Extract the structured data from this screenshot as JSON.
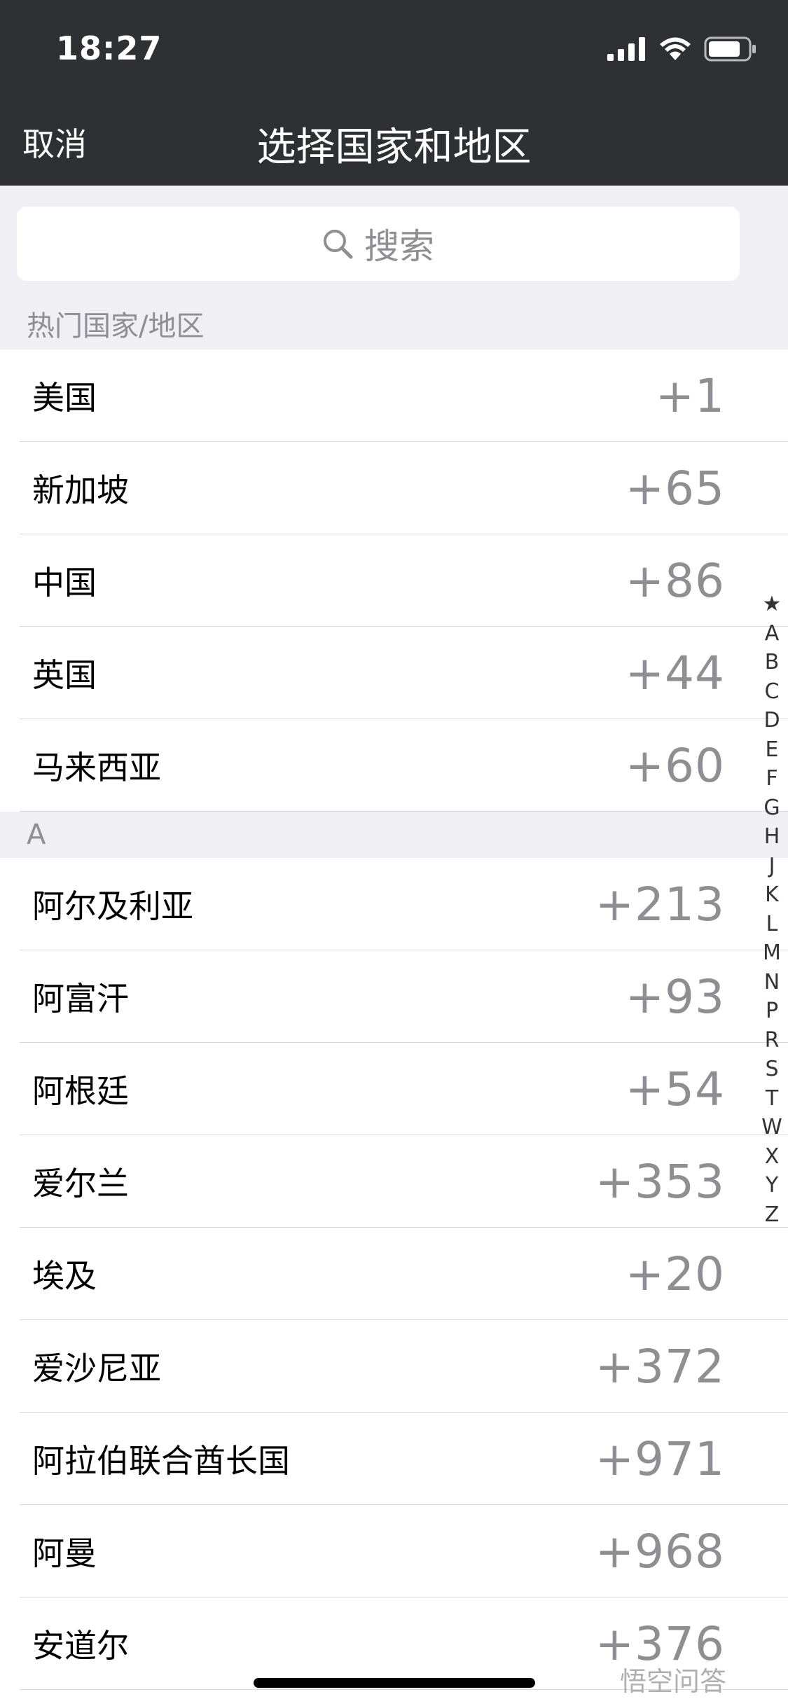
{
  "status_bar": {
    "time": "18:27"
  },
  "nav": {
    "cancel_label": "取消",
    "title": "选择国家和地区"
  },
  "search": {
    "placeholder": "搜索"
  },
  "popular": {
    "header": "热门国家/地区",
    "items": [
      {
        "name": "美国",
        "code": "+1"
      },
      {
        "name": "新加坡",
        "code": "+65"
      },
      {
        "name": "中国",
        "code": "+86"
      },
      {
        "name": "英国",
        "code": "+44"
      },
      {
        "name": "马来西亚",
        "code": "+60"
      }
    ]
  },
  "section_a": {
    "header": "A",
    "items": [
      {
        "name": "阿尔及利亚",
        "code": "+213"
      },
      {
        "name": "阿富汗",
        "code": "+93"
      },
      {
        "name": "阿根廷",
        "code": "+54"
      },
      {
        "name": "爱尔兰",
        "code": "+353"
      },
      {
        "name": "埃及",
        "code": "+20"
      },
      {
        "name": "爱沙尼亚",
        "code": "+372"
      },
      {
        "name": "阿拉伯联合酋长国",
        "code": "+971"
      },
      {
        "name": "阿曼",
        "code": "+968"
      },
      {
        "name": "安道尔",
        "code": "+376"
      }
    ]
  },
  "index_bar": [
    "★",
    "A",
    "B",
    "C",
    "D",
    "E",
    "F",
    "G",
    "H",
    "J",
    "K",
    "L",
    "M",
    "N",
    "P",
    "R",
    "S",
    "T",
    "W",
    "X",
    "Y",
    "Z"
  ],
  "watermark": "悟空问答"
}
